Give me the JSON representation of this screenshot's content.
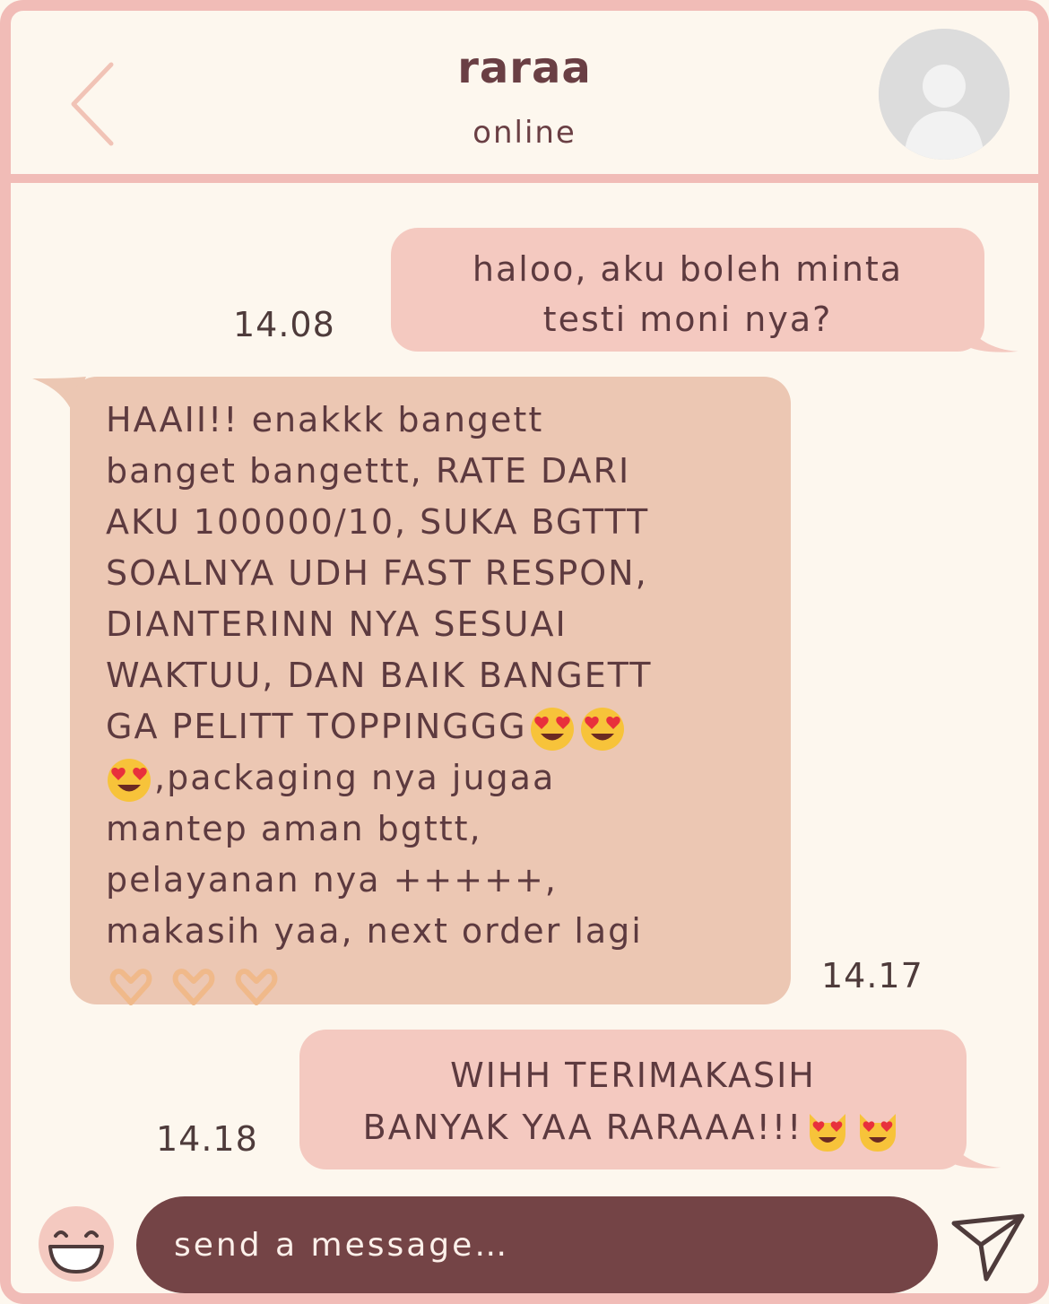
{
  "header": {
    "contact_name": "raraa",
    "status": "online",
    "back_icon": "chevron-left-icon",
    "avatar_icon": "default-avatar-icon"
  },
  "messages": [
    {
      "direction": "outgoing",
      "time": "14.08",
      "lines": [
        "haloo, aku boleh minta",
        "testi moni nya?"
      ]
    },
    {
      "direction": "incoming",
      "time": "14.17",
      "lines": [
        "HAAII!! enakkk bangett",
        "banget bangettt, RATE DARI",
        "AKU 100000/10, SUKA BGTTT",
        "SOALNYA UDH FAST RESPON,",
        "DIANTERINN NYA SESUAI",
        "WAKTUU, DAN BAIK BANGETT",
        "GA PELITT TOPPINGGG",
        ",packaging nya jugaa",
        "mantep aman bgttt,",
        "pelayanan nya +++++,",
        "makasih yaa, next order lagi"
      ],
      "emoji": [
        "heart-eyes-emoji",
        "heart-eyes-emoji",
        "heart-eyes-emoji",
        "heart-hands-emoji",
        "heart-hands-emoji",
        "heart-hands-emoji"
      ]
    },
    {
      "direction": "outgoing",
      "time": "14.18",
      "lines": [
        "WIHH TERIMAKASIH",
        "BANYAK YAA RARAAA!!!"
      ],
      "emoji": [
        "heart-eyes-cat-emoji",
        "heart-eyes-cat-emoji"
      ]
    }
  ],
  "composer": {
    "placeholder": "send a message…",
    "emoji_button_icon": "smiley-icon",
    "send_icon": "paper-plane-icon"
  },
  "colors": {
    "frame": "#f1bcb7",
    "background": "#fdf7ee",
    "outgoing_bubble": "#f4c9c0",
    "incoming_bubble": "#ecc7b3",
    "composer": "#744446",
    "text": "#5d3a3f"
  }
}
